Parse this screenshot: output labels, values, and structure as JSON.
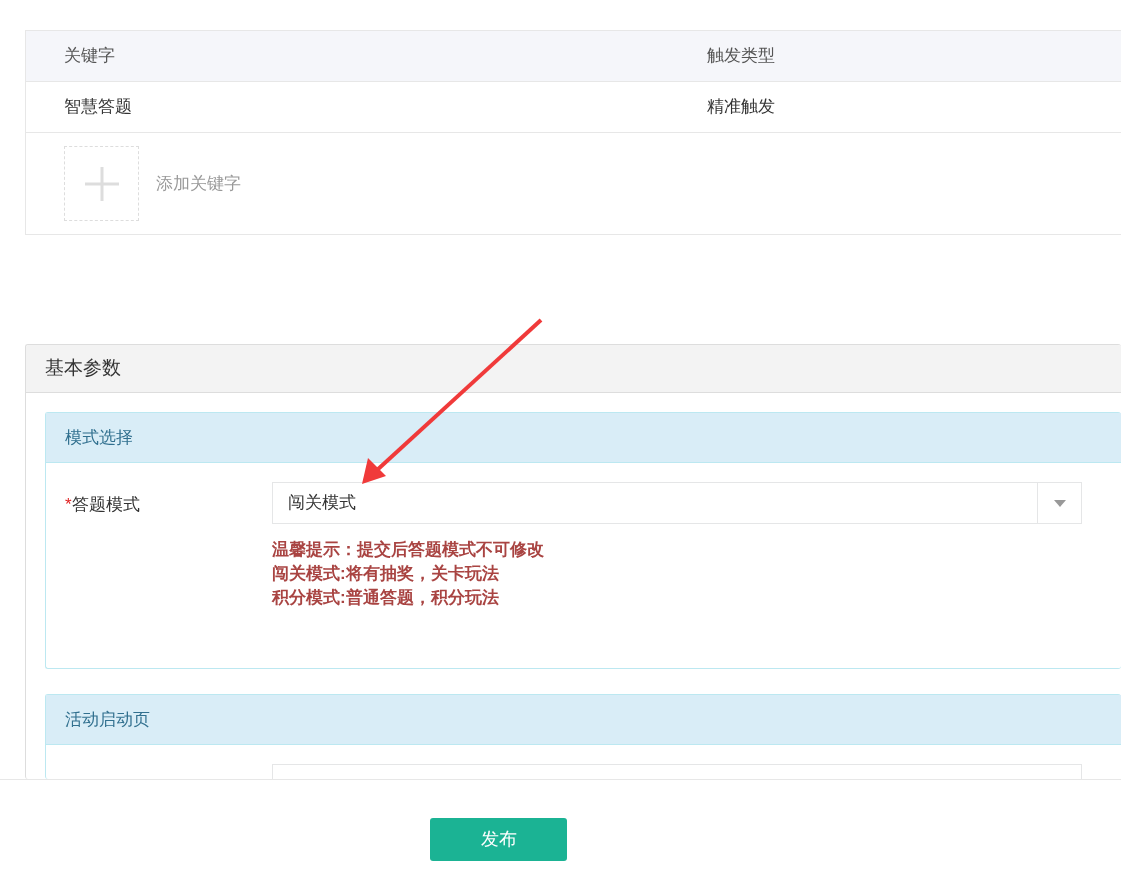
{
  "keyword_table": {
    "columns": [
      "关键字",
      "触发类型"
    ],
    "rows": [
      {
        "keyword": "智慧答题",
        "trigger_type": "精准触发"
      }
    ],
    "add_label": "添加关键字"
  },
  "basic_params": {
    "title": "基本参数",
    "mode_section": {
      "title": "模式选择",
      "required_mark": "*",
      "field_label": "答题模式",
      "value": "闯关模式",
      "hints": [
        "温馨提示：提交后答题模式不可修改",
        "闯关模式:将有抽奖，关卡玩法",
        "积分模式:普通答题，积分玩法"
      ]
    },
    "start_page_section": {
      "title": "活动启动页"
    }
  },
  "publish_button": "发布"
}
